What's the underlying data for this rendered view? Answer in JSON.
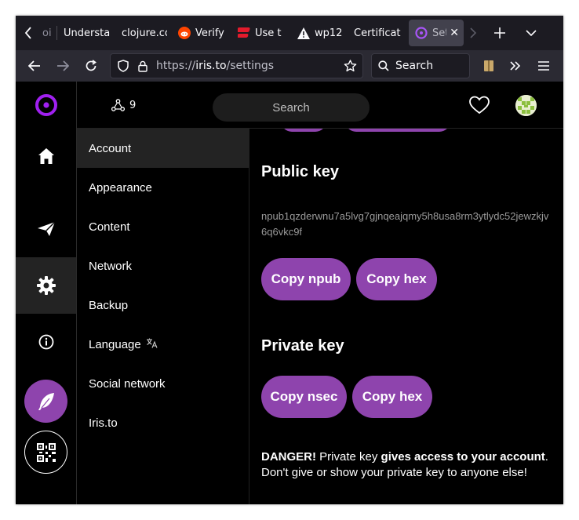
{
  "browser": {
    "tabs": [
      {
        "label": "Understa",
        "icon": "none"
      },
      {
        "label": "clojure.co",
        "icon": "none"
      },
      {
        "label": "Verify",
        "icon": "reddit-icon"
      },
      {
        "label": "Use t",
        "icon": "lastpass-icon"
      },
      {
        "label": "wp12",
        "icon": "warning-icon"
      },
      {
        "label": "Certificat",
        "icon": "none"
      },
      {
        "label": "Set",
        "icon": "iris-icon",
        "active": true
      }
    ],
    "partial_tab_label": "oi",
    "url": {
      "scheme": "https://",
      "host": "iris.to",
      "path": "/settings"
    },
    "search_placeholder": "Search"
  },
  "header": {
    "peer_count": "9",
    "search_placeholder": "Search"
  },
  "settings_menu": [
    {
      "label": "Account",
      "active": true
    },
    {
      "label": "Appearance"
    },
    {
      "label": "Content"
    },
    {
      "label": "Network"
    },
    {
      "label": "Backup"
    },
    {
      "label": "Language"
    },
    {
      "label": "Social network"
    },
    {
      "label": "Iris.to"
    }
  ],
  "account": {
    "public_key_title": "Public key",
    "public_key_value": "npub1qzderwnu7a5lvg7gjnqeajqmy5h8usa8rm3ytlydc52jewzkjv6q6vkc9f",
    "copy_npub": "Copy npub",
    "copy_pub_hex": "Copy hex",
    "private_key_title": "Private key",
    "copy_nsec": "Copy nsec",
    "copy_priv_hex": "Copy hex",
    "danger_label": "DANGER!",
    "danger_text_1": " Private key ",
    "danger_bold": "gives access to your account",
    "danger_text_2": ". Don't give or show your private key to anyone else!"
  },
  "colors": {
    "accent": "#8e44ad",
    "background": "#000000",
    "chrome_dark": "#1c1b22",
    "toolbar": "#2b2a33"
  }
}
